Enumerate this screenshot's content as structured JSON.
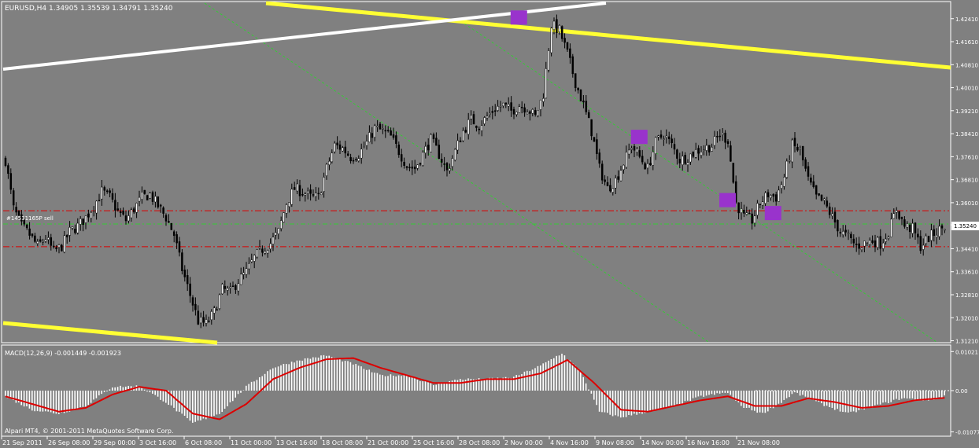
{
  "header": {
    "symbol_label": "EURUSD,H4",
    "ohlc_label": "1.34905 1.35539 1.34791 1.35240"
  },
  "order_label": "#14531165P sell",
  "current_price_label": "1.35240",
  "copyright": "Alpari MT4, © 2001-2011 MetaQuotes Software Corp.",
  "colors": {
    "background": "#808080",
    "candle": "#000000",
    "channel_yellow": "#ffff33",
    "trend_white": "#ffffff",
    "macd_signal": "#dd0000",
    "macd_hist": "#ffffff",
    "level_line": "#dd0000",
    "dotted_trend": "#33cc33",
    "marker": "#9933cc"
  },
  "chart_data": [
    {
      "type": "candlestick",
      "title": "EURUSD,H4",
      "x_tick_labels": [
        "21 Sep 2011",
        "26 Sep 08:00",
        "29 Sep 00:00",
        "3 Oct 16:00",
        "6 Oct 08:00",
        "11 Oct 00:00",
        "13 Oct 16:00",
        "18 Oct 08:00",
        "21 Oct 00:00",
        "25 Oct 16:00",
        "28 Oct 08:00",
        "2 Nov 00:00",
        "4 Nov 16:00",
        "9 Nov 08:00",
        "14 Nov 00:00",
        "16 Nov 16:00",
        "21 Nov 08:00"
      ],
      "y_ticks": [
        1.3121,
        1.3201,
        1.3281,
        1.3361,
        1.3441,
        1.3524,
        1.3601,
        1.3681,
        1.3761,
        1.3841,
        1.3921,
        1.4001,
        1.4081,
        1.4161,
        1.4241
      ],
      "ylim": [
        1.3117,
        1.4295
      ],
      "current_price": 1.3524,
      "horizontal_levels": [
        1.3573,
        1.3527,
        1.3448
      ],
      "close_path": [
        [
          0,
          1.375
        ],
        [
          3,
          1.358
        ],
        [
          6,
          1.352
        ],
        [
          9,
          1.349
        ],
        [
          12,
          1.345
        ],
        [
          15,
          1.348
        ],
        [
          18,
          1.343
        ],
        [
          21,
          1.345
        ],
        [
          24,
          1.35
        ],
        [
          27,
          1.352
        ],
        [
          30,
          1.355
        ],
        [
          33,
          1.359
        ],
        [
          36,
          1.364
        ],
        [
          39,
          1.362
        ],
        [
          42,
          1.357
        ],
        [
          45,
          1.354
        ],
        [
          48,
          1.358
        ],
        [
          51,
          1.362
        ],
        [
          54,
          1.363
        ],
        [
          57,
          1.359
        ],
        [
          60,
          1.355
        ],
        [
          63,
          1.349
        ],
        [
          66,
          1.337
        ],
        [
          69,
          1.328
        ],
        [
          72,
          1.319
        ],
        [
          75,
          1.318
        ],
        [
          78,
          1.322
        ],
        [
          81,
          1.33
        ],
        [
          84,
          1.329
        ],
        [
          87,
          1.333
        ],
        [
          90,
          1.336
        ],
        [
          93,
          1.341
        ],
        [
          96,
          1.344
        ],
        [
          99,
          1.346
        ],
        [
          102,
          1.35
        ],
        [
          105,
          1.36
        ],
        [
          108,
          1.365
        ],
        [
          111,
          1.364
        ],
        [
          114,
          1.362
        ],
        [
          117,
          1.362
        ],
        [
          120,
          1.372
        ],
        [
          123,
          1.38
        ],
        [
          126,
          1.379
        ],
        [
          129,
          1.376
        ],
        [
          132,
          1.377
        ],
        [
          135,
          1.381
        ],
        [
          138,
          1.386
        ],
        [
          141,
          1.385
        ],
        [
          144,
          1.383
        ],
        [
          147,
          1.378
        ],
        [
          150,
          1.373
        ],
        [
          153,
          1.372
        ],
        [
          156,
          1.377
        ],
        [
          159,
          1.382
        ],
        [
          162,
          1.377
        ],
        [
          165,
          1.371
        ],
        [
          168,
          1.378
        ],
        [
          171,
          1.385
        ],
        [
          174,
          1.389
        ],
        [
          177,
          1.387
        ],
        [
          180,
          1.39
        ],
        [
          183,
          1.393
        ],
        [
          186,
          1.394
        ],
        [
          189,
          1.392
        ],
        [
          192,
          1.394
        ],
        [
          195,
          1.393
        ],
        [
          198,
          1.39
        ],
        [
          201,
          1.398
        ],
        [
          204,
          1.422
        ],
        [
          207,
          1.42
        ],
        [
          210,
          1.412
        ],
        [
          213,
          1.402
        ],
        [
          216,
          1.394
        ],
        [
          219,
          1.385
        ],
        [
          222,
          1.372
        ],
        [
          225,
          1.365
        ],
        [
          228,
          1.368
        ],
        [
          231,
          1.374
        ],
        [
          234,
          1.38
        ],
        [
          237,
          1.376
        ],
        [
          240,
          1.372
        ],
        [
          243,
          1.381
        ],
        [
          246,
          1.384
        ],
        [
          249,
          1.38
        ],
        [
          252,
          1.375
        ],
        [
          255,
          1.376
        ],
        [
          258,
          1.378
        ],
        [
          261,
          1.379
        ],
        [
          264,
          1.38
        ],
        [
          267,
          1.384
        ],
        [
          270,
          1.382
        ],
        [
          273,
          1.36
        ],
        [
          276,
          1.355
        ],
        [
          279,
          1.354
        ],
        [
          282,
          1.36
        ],
        [
          285,
          1.363
        ],
        [
          288,
          1.362
        ],
        [
          291,
          1.369
        ],
        [
          294,
          1.38
        ],
        [
          297,
          1.378
        ],
        [
          300,
          1.368
        ],
        [
          303,
          1.362
        ],
        [
          306,
          1.36
        ],
        [
          309,
          1.355
        ],
        [
          312,
          1.35
        ],
        [
          315,
          1.348
        ],
        [
          318,
          1.345
        ],
        [
          321,
          1.346
        ],
        [
          324,
          1.347
        ],
        [
          327,
          1.346
        ],
        [
          330,
          1.35
        ],
        [
          333,
          1.358
        ],
        [
          336,
          1.352
        ],
        [
          339,
          1.351
        ],
        [
          342,
          1.345
        ],
        [
          345,
          1.348
        ],
        [
          348,
          1.35
        ],
        [
          351,
          1.352
        ]
      ]
    },
    {
      "type": "bar",
      "title": "MACD(12,26,9) -0.001449 -0.001923",
      "y_ticks": [
        0.01021,
        0.0,
        -0.01077
      ],
      "ylim": [
        -0.0115,
        0.0115
      ],
      "hist_path": [
        [
          0,
          -0.0015
        ],
        [
          10,
          -0.005
        ],
        [
          20,
          -0.006
        ],
        [
          30,
          -0.004
        ],
        [
          40,
          0.001
        ],
        [
          50,
          0.0012
        ],
        [
          60,
          -0.003
        ],
        [
          70,
          -0.0085
        ],
        [
          80,
          -0.006
        ],
        [
          90,
          0.001
        ],
        [
          100,
          0.006
        ],
        [
          110,
          0.008
        ],
        [
          120,
          0.0092
        ],
        [
          130,
          0.007
        ],
        [
          140,
          0.004
        ],
        [
          150,
          0.004
        ],
        [
          160,
          0.0015
        ],
        [
          170,
          0.003
        ],
        [
          180,
          0.003
        ],
        [
          190,
          0.0035
        ],
        [
          200,
          0.0065
        ],
        [
          208,
          0.0098
        ],
        [
          215,
          0.005
        ],
        [
          222,
          -0.0055
        ],
        [
          230,
          -0.007
        ],
        [
          240,
          -0.0055
        ],
        [
          250,
          -0.004
        ],
        [
          260,
          -0.0015
        ],
        [
          270,
          -0.0005
        ],
        [
          275,
          -0.004
        ],
        [
          283,
          -0.006
        ],
        [
          290,
          -0.003
        ],
        [
          295,
          -0.0005
        ],
        [
          305,
          -0.0035
        ],
        [
          315,
          -0.006
        ],
        [
          325,
          -0.004
        ],
        [
          335,
          -0.002
        ],
        [
          345,
          -0.0025
        ],
        [
          351,
          -0.0014
        ]
      ],
      "signal_path": [
        [
          0,
          -0.0015
        ],
        [
          10,
          -0.0035
        ],
        [
          20,
          -0.0055
        ],
        [
          30,
          -0.0045
        ],
        [
          40,
          -0.001
        ],
        [
          50,
          0.001
        ],
        [
          60,
          0.0
        ],
        [
          70,
          -0.006
        ],
        [
          80,
          -0.0075
        ],
        [
          90,
          -0.0035
        ],
        [
          100,
          0.003
        ],
        [
          110,
          0.006
        ],
        [
          120,
          0.0082
        ],
        [
          130,
          0.0085
        ],
        [
          140,
          0.006
        ],
        [
          150,
          0.004
        ],
        [
          160,
          0.002
        ],
        [
          170,
          0.002
        ],
        [
          180,
          0.003
        ],
        [
          190,
          0.003
        ],
        [
          200,
          0.0045
        ],
        [
          210,
          0.008
        ],
        [
          220,
          0.002
        ],
        [
          230,
          -0.005
        ],
        [
          240,
          -0.0055
        ],
        [
          250,
          -0.004
        ],
        [
          260,
          -0.0025
        ],
        [
          270,
          -0.0015
        ],
        [
          280,
          -0.004
        ],
        [
          290,
          -0.004
        ],
        [
          300,
          -0.002
        ],
        [
          310,
          -0.003
        ],
        [
          320,
          -0.0045
        ],
        [
          330,
          -0.004
        ],
        [
          340,
          -0.0025
        ],
        [
          351,
          -0.0019
        ]
      ]
    }
  ]
}
